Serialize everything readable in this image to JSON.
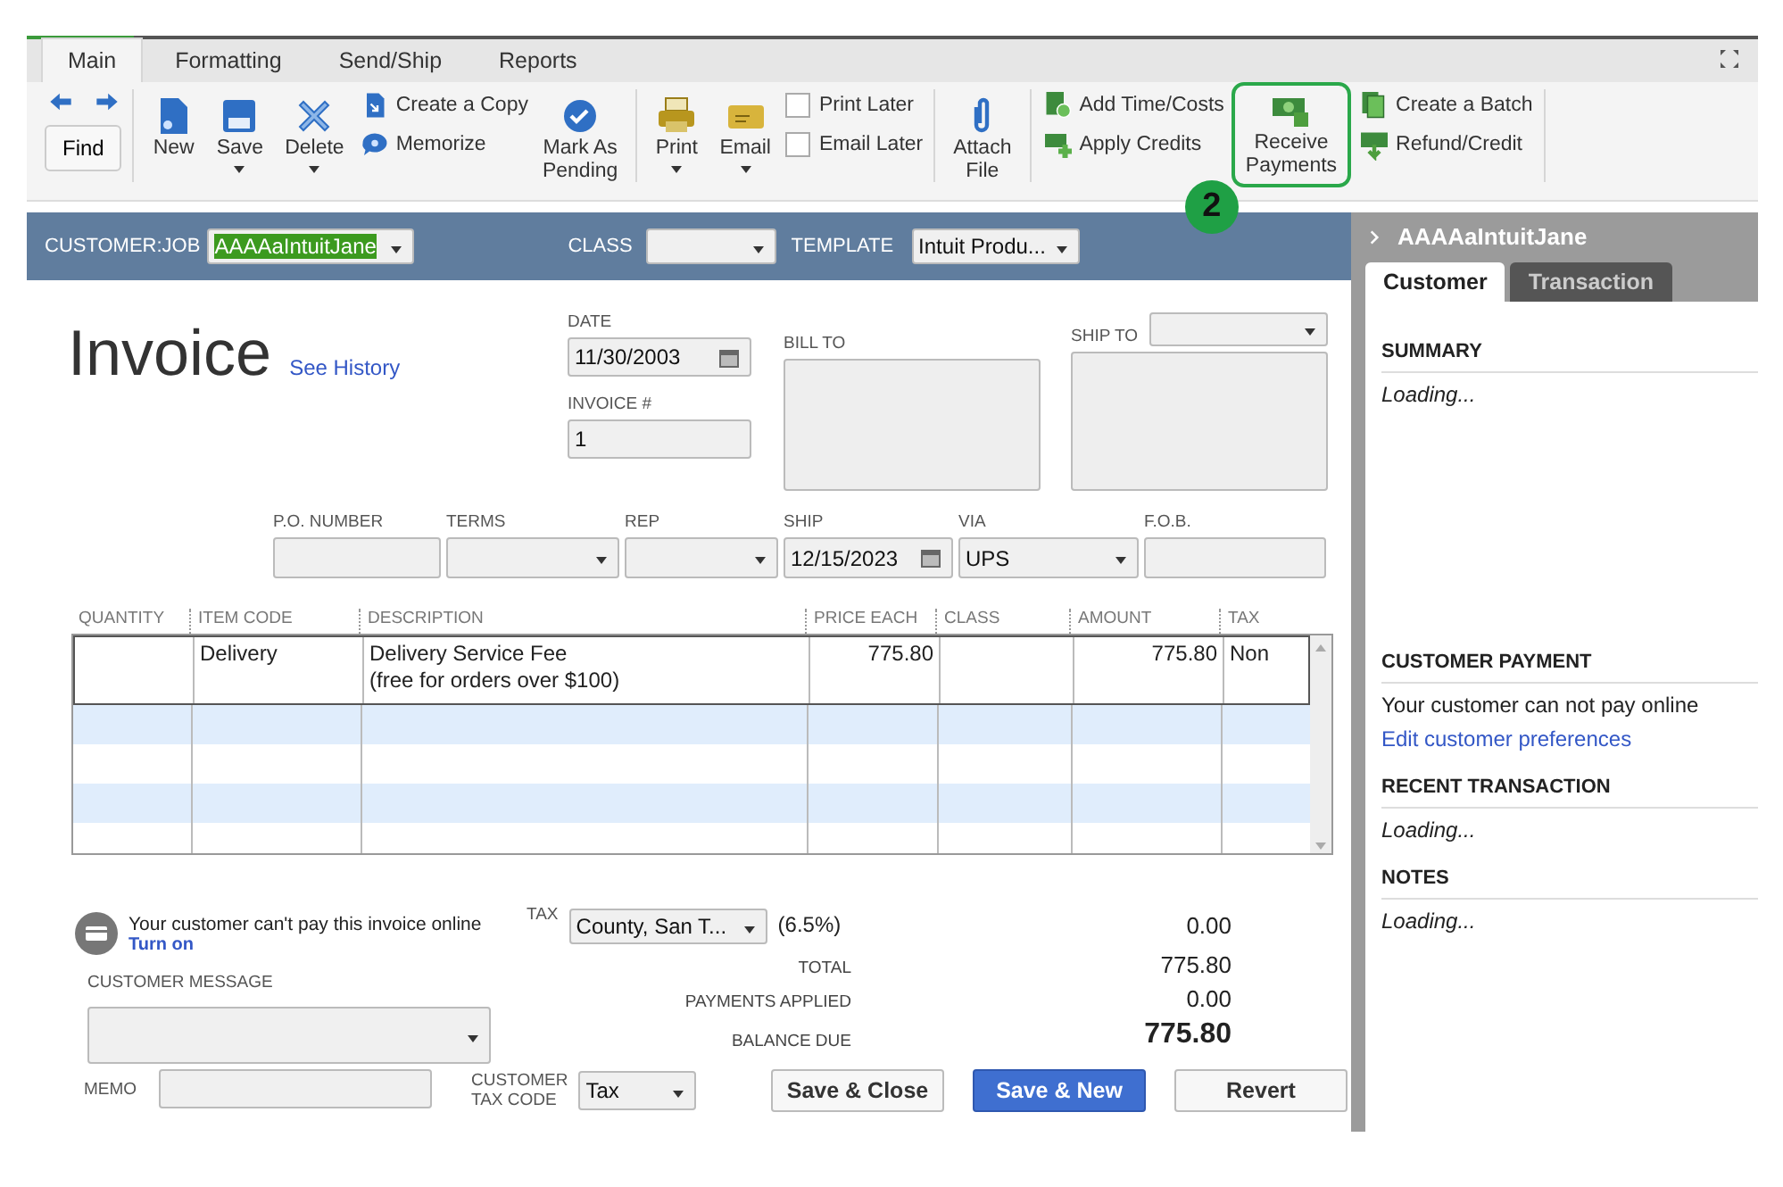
{
  "tabs": [
    {
      "label": "Main",
      "selected": true
    },
    {
      "label": "Formatting",
      "selected": false
    },
    {
      "label": "Send/Ship",
      "selected": false
    },
    {
      "label": "Reports",
      "selected": false
    }
  ],
  "toolbar": [
    [
      {
        "kind": "nav",
        "label": "Find"
      }
    ],
    [
      {
        "kind": "big",
        "label": "New",
        "caret": false
      },
      {
        "kind": "big",
        "label": "Save",
        "caret": true
      },
      {
        "kind": "big",
        "label": "Delete",
        "caret": true
      },
      {
        "kind": "stack",
        "items": [
          {
            "label": "Create a Copy"
          },
          {
            "label": "Memorize"
          }
        ]
      },
      {
        "kind": "big",
        "label": "Mark As\nPending",
        "caret": false
      }
    ],
    [
      {
        "kind": "big",
        "label": "Print",
        "caret": true
      },
      {
        "kind": "big",
        "label": "Email",
        "caret": true
      },
      {
        "kind": "checks",
        "items": [
          {
            "label": "Print Later",
            "checked": false
          },
          {
            "label": "Email Later",
            "checked": false
          }
        ]
      }
    ],
    [
      {
        "kind": "big",
        "label": "Attach\nFile",
        "caret": false
      }
    ],
    [
      {
        "kind": "stack",
        "items": [
          {
            "label": "Add Time/Costs"
          },
          {
            "label": "Apply Credits"
          }
        ]
      },
      {
        "kind": "big",
        "label": "Receive\nPayments",
        "caret": false,
        "highlighted": true,
        "badge": "2"
      },
      {
        "kind": "stack",
        "items": [
          {
            "label": "Create a Batch"
          },
          {
            "label": "Refund/Credit"
          }
        ]
      }
    ]
  ],
  "header": {
    "customer_job": {
      "label": "CUSTOMER:JOB",
      "value": "AAAAaIntuitJane"
    },
    "class": {
      "label": "CLASS"
    },
    "template": {
      "label": "TEMPLATE",
      "value": "Intuit Produ..."
    }
  },
  "form": {
    "title": "Invoice",
    "history_link": "See History",
    "date": {
      "label": "DATE",
      "value": "11/30/2003"
    },
    "invoice_number": {
      "label": "INVOICE #",
      "value": "1"
    },
    "bill_to": {
      "label": "BILL TO"
    },
    "ship_to": {
      "label": "SHIP TO"
    },
    "fields": [
      {
        "kind": "text",
        "label": "P.O. NUMBER"
      },
      {
        "kind": "dropdown",
        "label": "TERMS"
      },
      {
        "kind": "dropdown",
        "label": "REP"
      },
      {
        "kind": "date",
        "label": "SHIP",
        "value": "12/15/2023"
      },
      {
        "kind": "dropdown",
        "label": "VIA",
        "value": "UPS"
      },
      {
        "kind": "text",
        "label": "F.O.B."
      }
    ]
  },
  "table": {
    "columns": [
      "QUANTITY",
      "ITEM CODE",
      "DESCRIPTION",
      "PRICE EACH",
      "CLASS",
      "AMOUNT",
      "TAX"
    ],
    "rows": [
      [
        null,
        "Delivery",
        "Delivery Service Fee\n(free for orders over $100)",
        "775.80",
        null,
        "775.80",
        "Non"
      ]
    ]
  },
  "footer": {
    "online_payment": {
      "message": "Your customer can't pay this invoice online",
      "link": "Turn on"
    },
    "customer_message": {
      "label": "CUSTOMER MESSAGE"
    },
    "memo": {
      "label": "MEMO"
    },
    "tax": {
      "label": "TAX",
      "value": "County, San T...",
      "rate": "(6.5%)",
      "amount": "0.00"
    },
    "totals": [
      {
        "label": "TOTAL",
        "value": "775.80",
        "kind": "plain"
      },
      {
        "label": "PAYMENTS APPLIED",
        "value": "0.00",
        "kind": "plain"
      },
      {
        "label": "BALANCE DUE",
        "value": "775.80",
        "kind": "emphasis"
      }
    ],
    "customer_tax_code": {
      "label": "CUSTOMER\nTAX CODE",
      "value": "Tax"
    },
    "buttons": [
      {
        "label": "Save & Close",
        "kind": "default"
      },
      {
        "label": "Save & New",
        "kind": "primary"
      },
      {
        "label": "Revert",
        "kind": "default"
      }
    ]
  },
  "side_panel": {
    "title": "AAAAaIntuitJane",
    "tabs": [
      {
        "label": "Customer",
        "selected": true
      },
      {
        "label": "Transaction",
        "selected": false
      }
    ],
    "sections": [
      {
        "heading": "SUMMARY",
        "lines": [
          {
            "kind": "loading",
            "text": "Loading..."
          }
        ]
      },
      {
        "heading": "CUSTOMER PAYMENT",
        "lines": [
          {
            "kind": "text",
            "text": "Your customer can not pay online"
          },
          {
            "kind": "link",
            "text": "Edit customer preferences"
          }
        ]
      },
      {
        "heading": "RECENT TRANSACTION",
        "lines": [
          {
            "kind": "loading",
            "text": "Loading..."
          }
        ]
      },
      {
        "heading": "NOTES",
        "lines": [
          {
            "kind": "loading",
            "text": "Loading..."
          }
        ]
      }
    ]
  }
}
